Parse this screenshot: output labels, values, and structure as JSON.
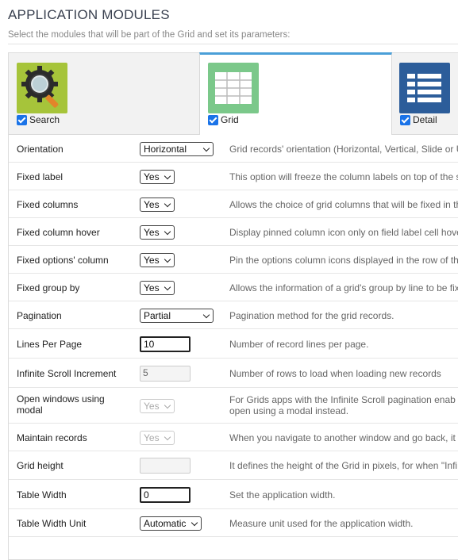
{
  "header": {
    "title": "APPLICATION MODULES",
    "subtitle": "Select the modules that will be part of the Grid and set its parameters:"
  },
  "modules": [
    {
      "label": "Search",
      "icon": "magnifier-gear-icon",
      "checked": true,
      "active": false
    },
    {
      "label": "Grid",
      "icon": "grid-table-icon",
      "checked": true,
      "active": true
    },
    {
      "label": "Detail",
      "icon": "detail-list-icon",
      "checked": true,
      "active": false
    }
  ],
  "rows": [
    {
      "label": "Orientation",
      "control": "select",
      "value": "Horizontal",
      "desc": "Grid records' orientation (Horizontal, Vertical, Slide or U"
    },
    {
      "label": "Fixed label",
      "control": "select",
      "value": "Yes",
      "desc": "This option will freeze the column labels on top of the s"
    },
    {
      "label": "Fixed columns",
      "control": "select",
      "value": "Yes",
      "desc": "Allows the choice of grid columns that will be fixed in th"
    },
    {
      "label": "Fixed column hover",
      "control": "select",
      "value": "Yes",
      "desc": "Display pinned column icon only on field label cell hove"
    },
    {
      "label": "Fixed options' column",
      "control": "select",
      "value": "Yes",
      "desc": "Pin the options column icons displayed in the row of th"
    },
    {
      "label": "Fixed group by",
      "control": "select",
      "value": "Yes",
      "desc": "Allows the information of a grid's group by line to be fix"
    },
    {
      "label": "Pagination",
      "control": "select",
      "value": "Partial",
      "desc": "Pagination method for the grid records."
    },
    {
      "label": "Lines Per Page",
      "control": "input",
      "value": "10",
      "desc": "Number of record lines per page."
    },
    {
      "label": "Infinite Scroll Increment",
      "control": "input",
      "value": "5",
      "disabled": true,
      "desc": "Number of rows to load when loading new records"
    },
    {
      "label": "Open windows using",
      "label2": "modal",
      "control": "select",
      "value": "Yes",
      "disabled": true,
      "desc": "For Grids apps with the Infinite Scroll pagination enab",
      "desc2": "open using a modal instead."
    },
    {
      "label": "Maintain records",
      "control": "select",
      "value": "Yes",
      "disabled": true,
      "desc": "When you navigate to another window and go back, it"
    },
    {
      "label": "Grid height",
      "control": "input",
      "value": "",
      "disabled": true,
      "desc": "It defines the height of the Grid in pixels, for when \"Infi"
    },
    {
      "label": "Table Width",
      "control": "input",
      "value": "0",
      "desc": "Set the application width."
    },
    {
      "label": "Table Width Unit",
      "control": "select",
      "value": "Automatic",
      "desc": "Measure unit used for the application width."
    }
  ]
}
